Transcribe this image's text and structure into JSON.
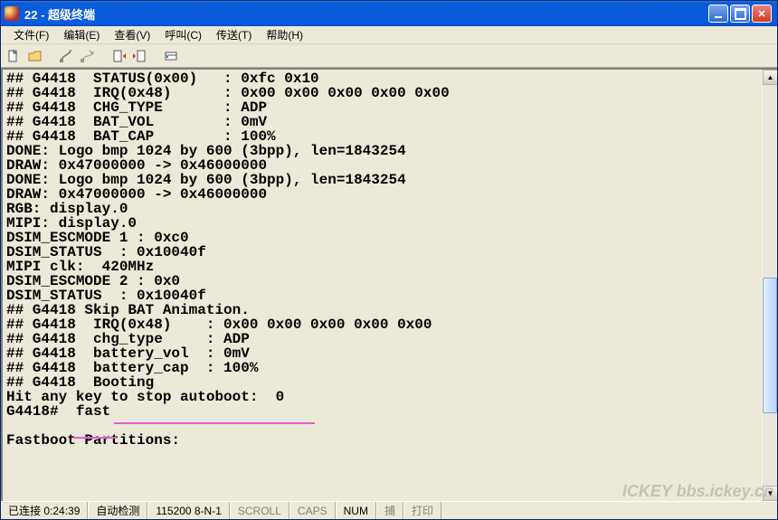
{
  "title": "22 - 超级终端",
  "menus": {
    "file": "文件(F)",
    "edit": "编辑(E)",
    "view": "查看(V)",
    "call": "呼叫(C)",
    "transfer": "传送(T)",
    "help": "帮助(H)"
  },
  "terminal_lines": [
    "## G4418  STATUS(0x00)   : 0xfc 0x10",
    "## G4418  IRQ(0x48)      : 0x00 0x00 0x00 0x00 0x00",
    "## G4418  CHG_TYPE       : ADP",
    "## G4418  BAT_VOL        : 0mV",
    "## G4418  BAT_CAP        : 100%",
    "DONE: Logo bmp 1024 by 600 (3bpp), len=1843254",
    "DRAW: 0x47000000 -> 0x46000000",
    "DONE: Logo bmp 1024 by 600 (3bpp), len=1843254",
    "DRAW: 0x47000000 -> 0x46000000",
    "RGB: display.0",
    "MIPI: display.0",
    "DSIM_ESCMODE 1 : 0xc0",
    "DSIM_STATUS  : 0x10040f",
    "MIPI clk:  420MHz",
    "DSIM_ESCMODE 2 : 0x0",
    "DSIM_STATUS  : 0x10040f",
    "## G4418 Skip BAT Animation.",
    "## G4418  IRQ(0x48)    : 0x00 0x00 0x00 0x00 0x00",
    "## G4418  chg_type     : ADP",
    "## G4418  battery_vol  : 0mV",
    "## G4418  battery_cap  : 100%",
    "## G4418  Booting",
    "Hit any key to stop autoboot:  0",
    "G4418#  fast",
    "",
    "Fastboot Partitions:"
  ],
  "status": {
    "conn": "已连接 0:24:39",
    "detect": "自动检测",
    "baud": "115200 8-N-1",
    "scroll": "SCROLL",
    "caps": "CAPS",
    "num": "NUM",
    "capture": "捕",
    "print": "打印"
  },
  "watermark": "ICKEY\nbbs.ickey.cn"
}
